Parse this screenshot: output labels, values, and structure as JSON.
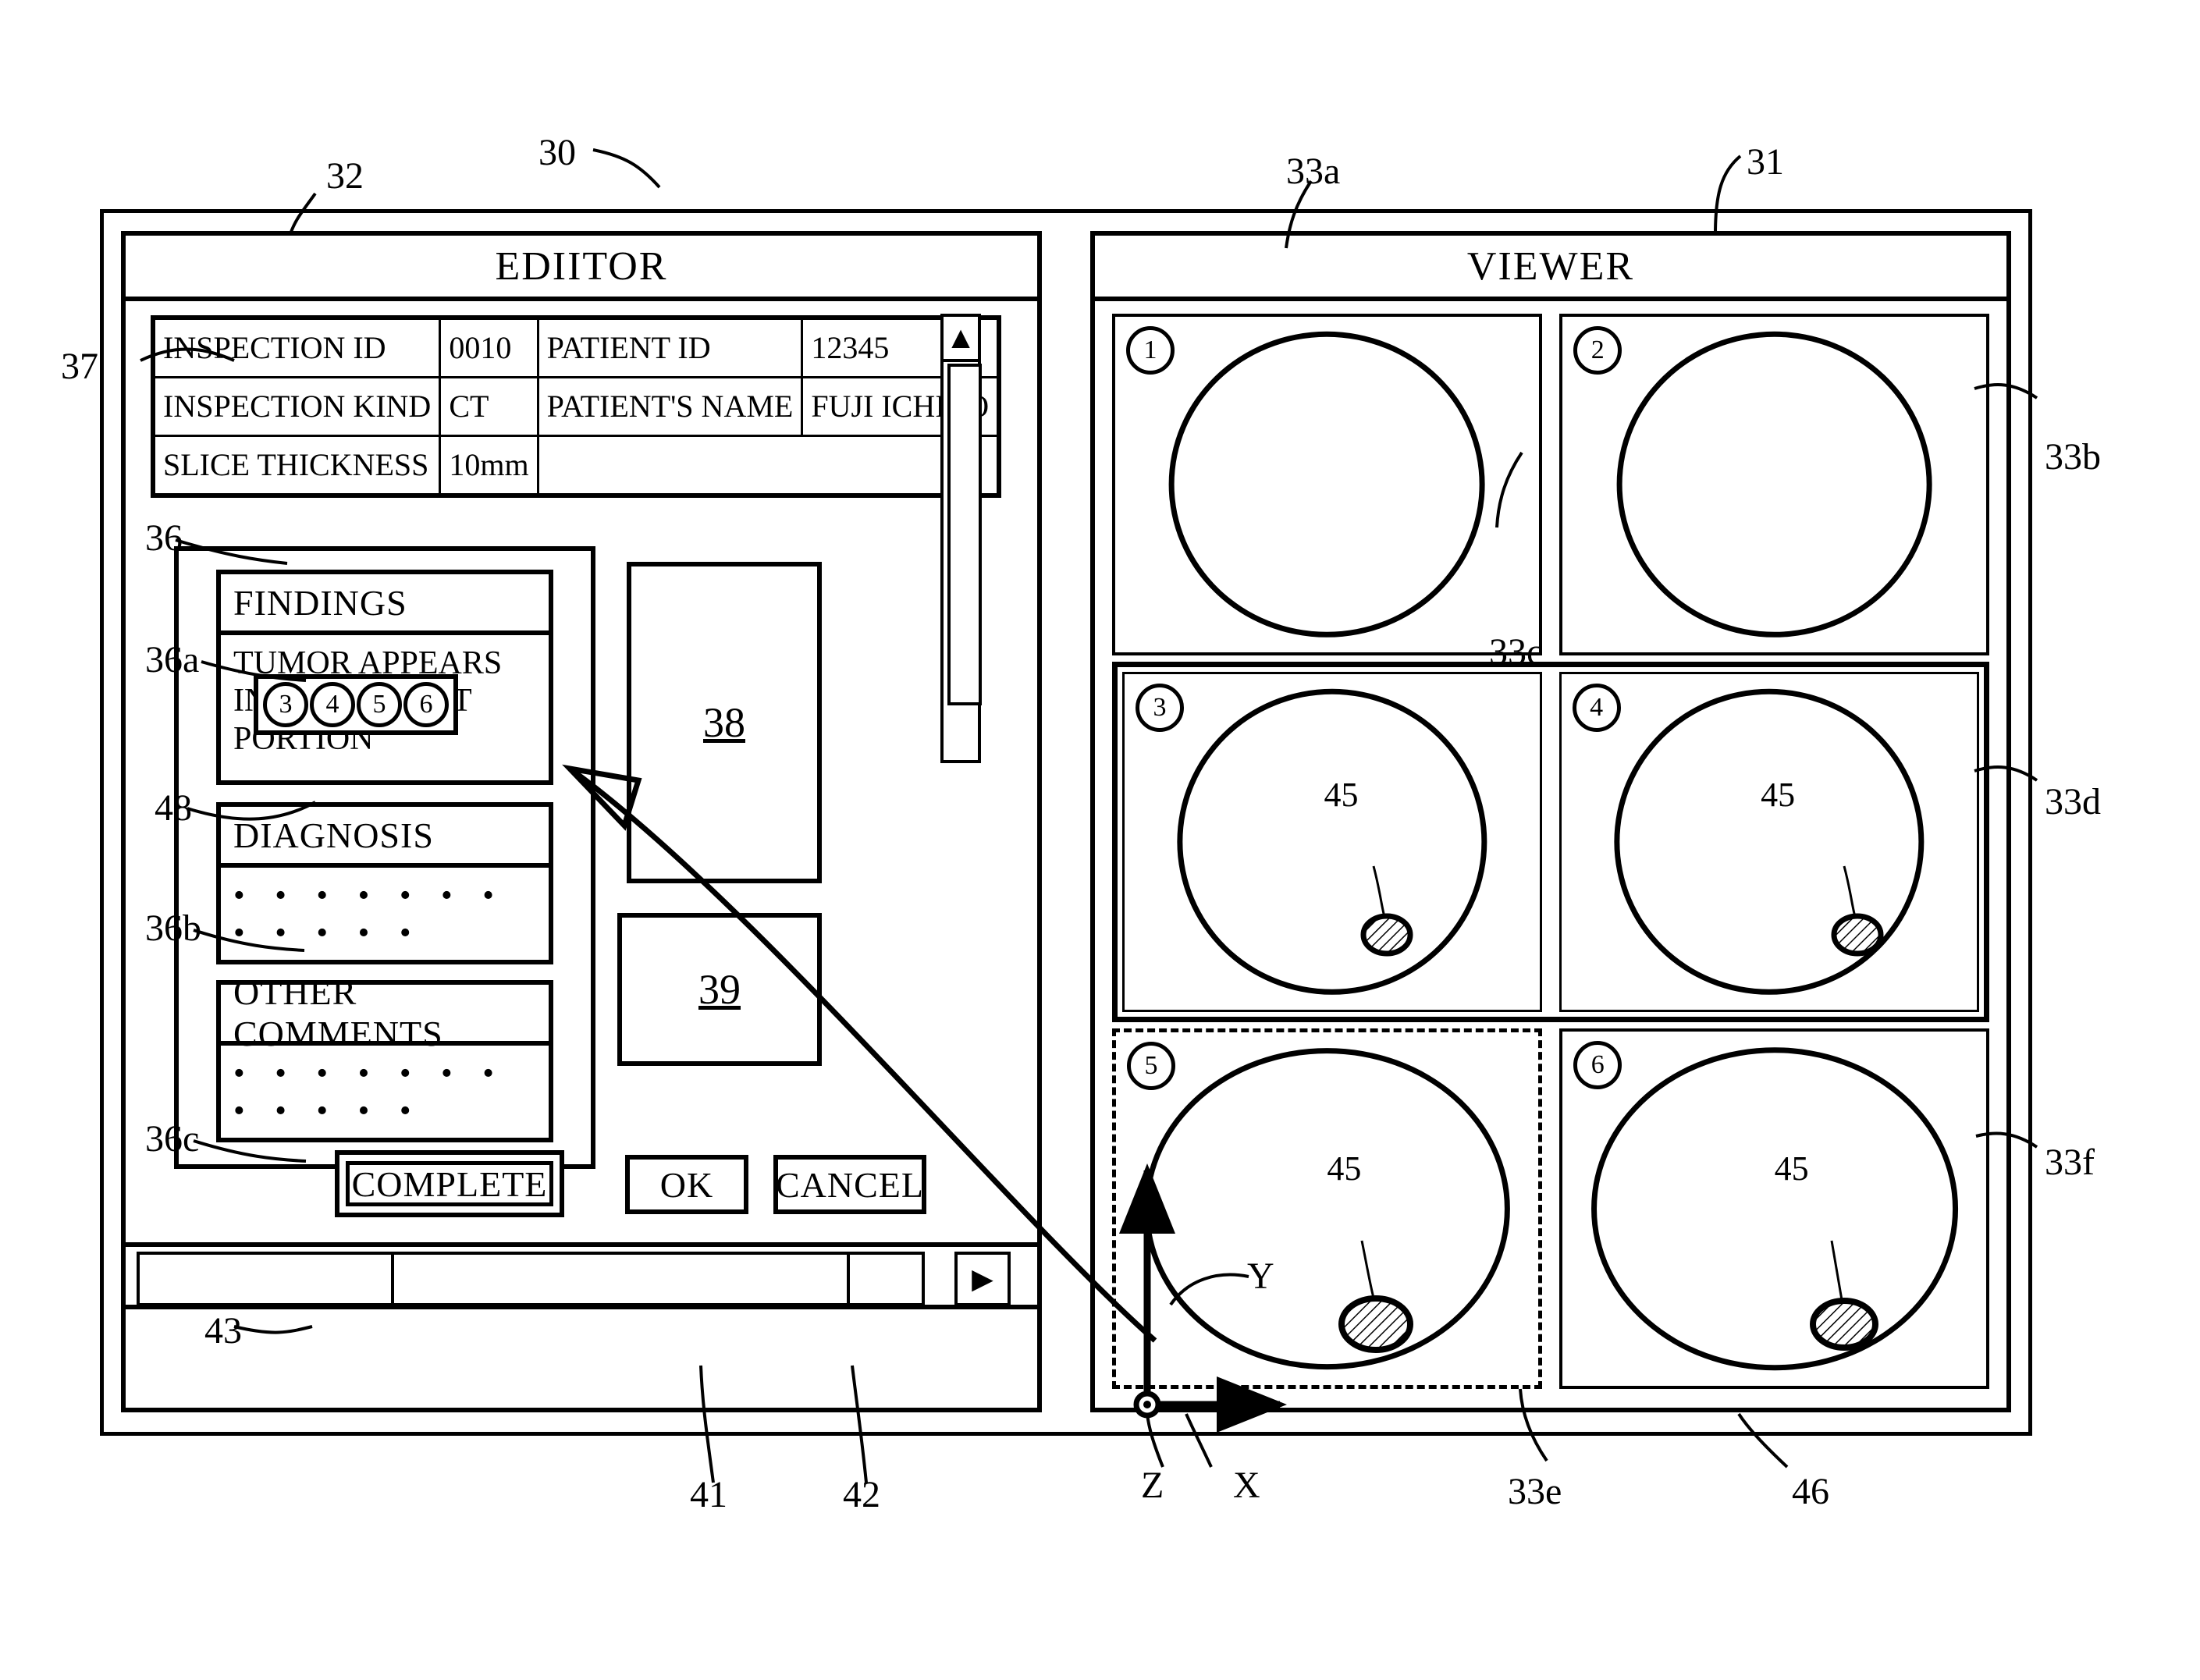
{
  "figure": {
    "window_ref": "30",
    "editor_ref": "32",
    "viewer_ref": "31",
    "info_table_ref": "37",
    "report_group_ref": "36",
    "findings_ref": "36a",
    "chips_ref": "48",
    "diagnosis_ref": "36b",
    "comments_ref": "36c",
    "complete_ref": "43",
    "ok_ref": "41",
    "cancel_ref": "42",
    "box38_ref": "38",
    "box39_ref": "39",
    "viewer_cell_refs": [
      "33a",
      "33b",
      "33c",
      "33d",
      "33e",
      "33f"
    ],
    "viewer_frame_ref": "46",
    "axis_x": "X",
    "axis_y": "Y",
    "axis_z": "Z",
    "tumor_ref": "45"
  },
  "editor": {
    "title": "EDIITOR",
    "info_table": {
      "rows": [
        {
          "key1": "INSPECTION ID",
          "val1": "0010",
          "key2": "PATIENT ID",
          "val2": "12345"
        },
        {
          "key1": "INSPECTION KIND",
          "val1": "CT",
          "key2": "PATIENT'S NAME",
          "val2": "FUJI ICHIRO"
        },
        {
          "key1": "SLICE THICKNESS",
          "val1": "10mm",
          "key2": "",
          "val2": ""
        }
      ]
    },
    "sections": [
      {
        "title": "FINDINGS",
        "text": "TUMOR APPEARS IN REAR RIGHT PORTION"
      },
      {
        "title": "DIAGNOSIS",
        "text": "• • • • • • • • • • • •"
      },
      {
        "title": "OTHER COMMENTS",
        "text": "• • • • • • • • • • • •"
      }
    ],
    "slice_chips": [
      "3",
      "4",
      "5",
      "6"
    ],
    "placeholder_box_1": "38",
    "placeholder_box_2": "39",
    "buttons": {
      "complete": "COMPLETE",
      "ok": "OK",
      "cancel": "CANCEL"
    },
    "scroll": {
      "up_arrow": "▲",
      "right_arrow": "▶"
    }
  },
  "viewer": {
    "title": "VIEWER",
    "cells": [
      {
        "number": "1",
        "shape": "tall-ellipse",
        "tumor": false,
        "tumor_label": "",
        "selected": false
      },
      {
        "number": "2",
        "shape": "tall-ellipse",
        "tumor": false,
        "tumor_label": "",
        "selected": false
      },
      {
        "number": "3",
        "shape": "tall-ellipse",
        "tumor": true,
        "tumor_label": "45",
        "selected": false
      },
      {
        "number": "4",
        "shape": "tall-ellipse",
        "tumor": true,
        "tumor_label": "45",
        "selected": false
      },
      {
        "number": "5",
        "shape": "round",
        "tumor": true,
        "tumor_label": "45",
        "selected": true
      },
      {
        "number": "6",
        "shape": "round",
        "tumor": true,
        "tumor_label": "45",
        "selected": false
      }
    ]
  },
  "colors": {
    "line": "#000000",
    "background": "#ffffff"
  }
}
